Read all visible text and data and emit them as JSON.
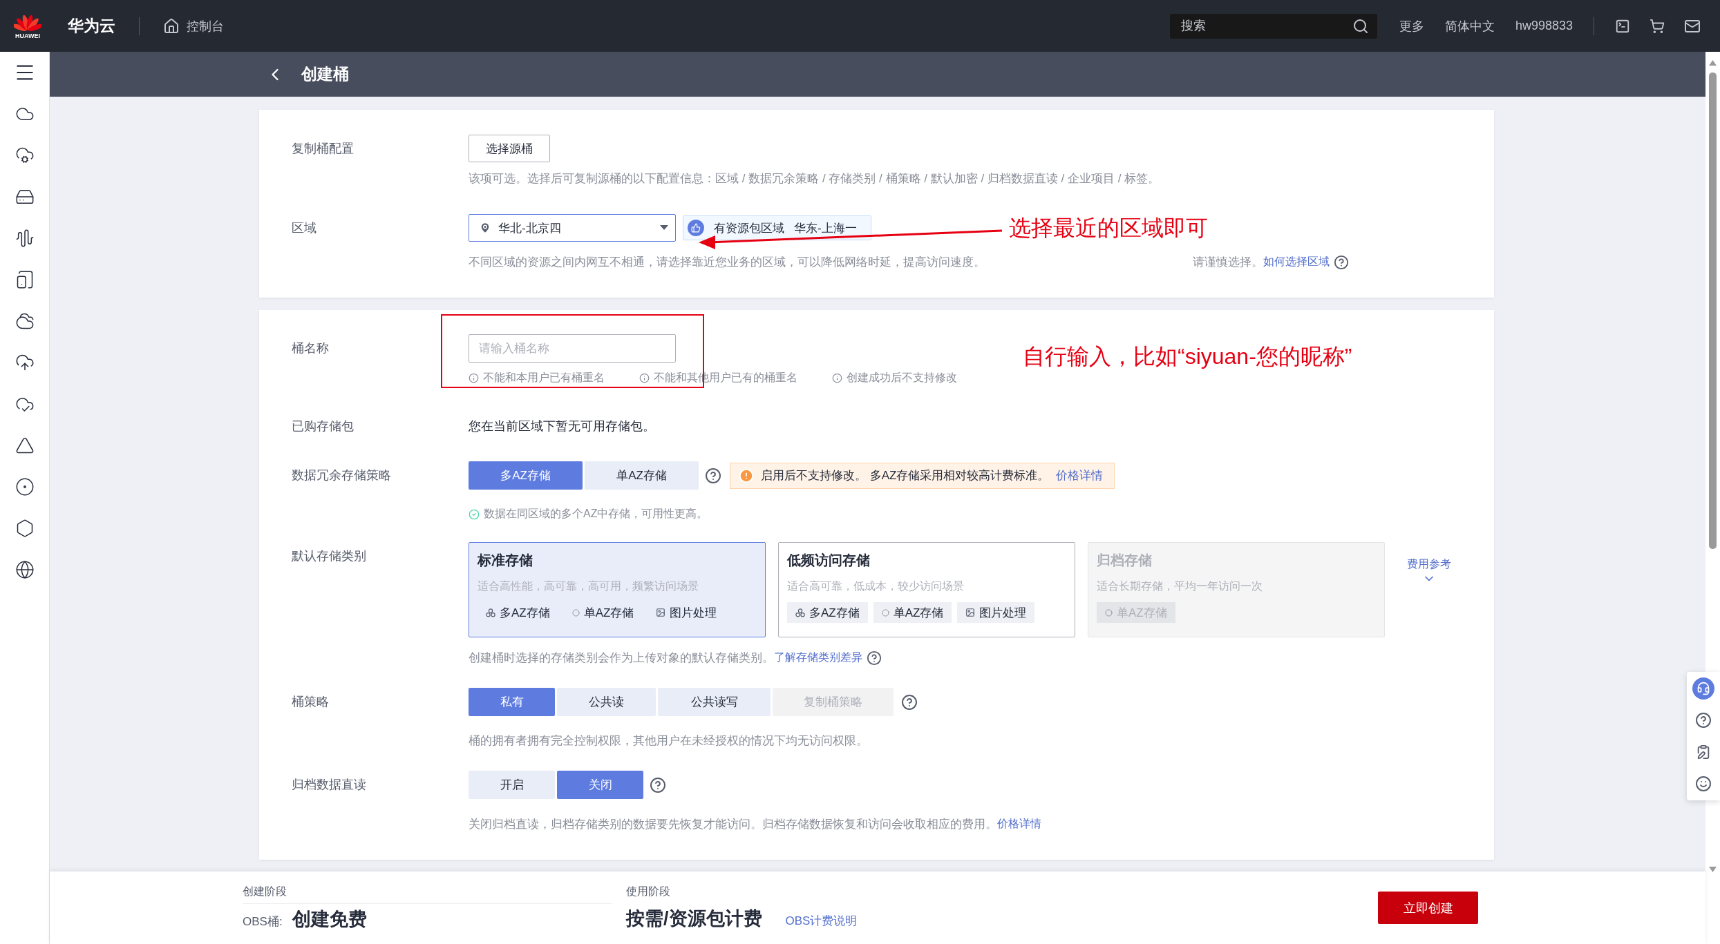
{
  "topbar": {
    "logo_text": "HUAWEI",
    "brand": "华为云",
    "console": "控制台",
    "search": {
      "placeholder": "搜索"
    },
    "links": [
      "更多",
      "简体中文",
      "hw998833"
    ]
  },
  "header": {
    "title": "创建桶"
  },
  "replicate": {
    "label": "复制桶配置",
    "button": "选择源桶",
    "hint": "该项可选。选择后可复制源桶的以下配置信息：区域 / 数据冗余策略 / 存储类别 / 桶策略 / 默认加密 / 归档数据直读 / 企业项目 / 标签。"
  },
  "region": {
    "label": "区域",
    "value": "华北-北京四",
    "recommend": [
      "有资源包区域",
      "华东-上海一"
    ],
    "hint_before": "不同区域的资源之间内网互不相通，请选择靠近您业务的区域，可以降低网络时延，提高访问速度。",
    "hint_after": "请谨慎选择。",
    "link": "如何选择区域",
    "annotation": "选择最近的区域即可"
  },
  "bucket_name": {
    "label": "桶名称",
    "placeholder": "请输入桶名称",
    "rules": [
      "不能和本用户已有桶重名",
      "不能和其他用户已有的桶重名",
      "创建成功后不支持修改"
    ],
    "annotation": "自行输入，比如“siyuan-您的昵称”"
  },
  "package": {
    "label": "已购存储包",
    "value": "您在当前区域下暂无可用存储包。"
  },
  "redundancy": {
    "label": "数据冗余存储策略",
    "options": [
      {
        "label": "多AZ存储",
        "selected": true
      },
      {
        "label": "单AZ存储",
        "selected": false
      }
    ],
    "warning": "启用后不支持修改。 多AZ存储采用相对较高计费标准。",
    "warning_link": "价格详情",
    "note": "数据在同区域的多个AZ中存储，可用性更高。"
  },
  "storage_class": {
    "label": "默认存储类别",
    "options": [
      {
        "title": "标准存储",
        "desc": "适合高性能，高可靠，高可用，频繁访问场景",
        "selected": true,
        "disabled": false,
        "tags": [
          {
            "kind": "multi",
            "label": "多AZ存储"
          },
          {
            "kind": "single",
            "label": "单AZ存储"
          },
          {
            "kind": "image",
            "label": "图片处理"
          }
        ]
      },
      {
        "title": "低频访问存储",
        "desc": "适合高可靠，低成本，较少访问场景",
        "selected": false,
        "disabled": false,
        "tags": [
          {
            "kind": "multi",
            "label": "多AZ存储"
          },
          {
            "kind": "single",
            "label": "单AZ存储"
          },
          {
            "kind": "image",
            "label": "图片处理"
          }
        ]
      },
      {
        "title": "归档存储",
        "desc": "适合长期存储，平均一年访问一次",
        "selected": false,
        "disabled": true,
        "tags": [
          {
            "kind": "single",
            "label": "单AZ存储"
          }
        ]
      }
    ],
    "fee_link": "费用参考",
    "hint": "创建桶时选择的存储类别会作为上传对象的默认存储类别。",
    "link": "了解存储类别差异"
  },
  "policy": {
    "label": "桶策略",
    "options": [
      {
        "label": "私有",
        "selected": true,
        "disabled": false
      },
      {
        "label": "公共读",
        "selected": false,
        "disabled": false
      },
      {
        "label": "公共读写",
        "selected": false,
        "disabled": false
      },
      {
        "label": "复制桶策略",
        "selected": false,
        "disabled": true
      }
    ],
    "hint": "桶的拥有者拥有完全控制权限，其他用户在未经授权的情况下均无访问权限。"
  },
  "archive_read": {
    "label": "归档数据直读",
    "options": [
      {
        "label": "开启",
        "selected": false
      },
      {
        "label": "关闭",
        "selected": true
      }
    ],
    "hint": "关闭归档直读，归档存储类别的数据要先恢复才能访问。归档存储数据恢复和访问会收取相应的费用。",
    "link": "价格详情"
  },
  "footer": {
    "create_stage": {
      "label": "创建阶段",
      "prefix": "OBS桶:",
      "value": "创建免费"
    },
    "use_stage": {
      "label": "使用阶段",
      "value": "按需/资源包计费",
      "link": "OBS计费说明"
    },
    "submit": "立即创建"
  }
}
